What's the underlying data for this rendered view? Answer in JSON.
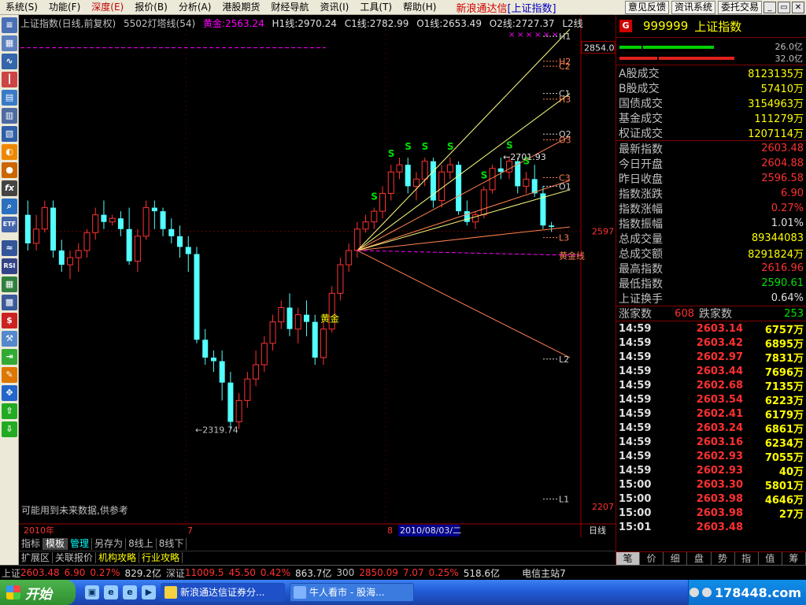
{
  "menubar": {
    "items": [
      "系统(S)",
      "功能(F)",
      "深度(E)",
      "报价(B)",
      "分析(A)",
      "港股期货",
      "财经导航",
      "资讯(I)",
      "工具(T)",
      "帮助(H)"
    ],
    "active_index": 2,
    "app_title": "新浪通达信",
    "app_title_bracket": "[上证指数]",
    "buttons": [
      "意见反馈",
      "资讯系统",
      "委托交易"
    ]
  },
  "chart": {
    "header_name": "上证指数(日线,前复权)",
    "header_tool": "5502灯塔线(54)",
    "header_gold": "黄金:2563.24",
    "header_lines": [
      "H1线:2970.24",
      "C1线:2782.99",
      "O1线:2653.49",
      "O2线:2727.37",
      "L2线"
    ],
    "price_axis": {
      "top_box": "2854.0",
      "mid": "2597",
      "bottom": "2207"
    },
    "annotations": {
      "high": "2701.93",
      "low": "←2319.74",
      "gold": "黄金",
      "gold_line": "黄金线"
    },
    "line_labels": [
      "H1",
      "H2",
      "C2",
      "C1",
      "H3",
      "O2",
      "O3",
      "C3",
      "O1",
      "L3",
      "L2",
      "L1"
    ],
    "signal_label": "S",
    "footnote": "可能用到未来数据,供参考",
    "time_axis": {
      "year": "2010年",
      "m7": "7",
      "m8": "8",
      "cursor_date": "2010/08/03/二",
      "period": "日线"
    }
  },
  "chart_data": {
    "type": "candlestick",
    "ylim": [
      2207,
      2880
    ],
    "candles": [
      [
        2620,
        2640,
        2570,
        2580
      ],
      [
        2580,
        2620,
        2570,
        2600
      ],
      [
        2600,
        2640,
        2595,
        2630
      ],
      [
        2630,
        2640,
        2560,
        2570
      ],
      [
        2570,
        2585,
        2540,
        2550
      ],
      [
        2550,
        2570,
        2530,
        2560
      ],
      [
        2560,
        2580,
        2540,
        2570
      ],
      [
        2570,
        2600,
        2560,
        2595
      ],
      [
        2595,
        2630,
        2585,
        2620
      ],
      [
        2620,
        2640,
        2600,
        2610
      ],
      [
        2610,
        2620,
        2605,
        2615
      ],
      [
        2615,
        2625,
        2590,
        2600
      ],
      [
        2600,
        2630,
        2550,
        2555
      ],
      [
        2555,
        2600,
        2540,
        2590
      ],
      [
        2590,
        2640,
        2585,
        2630
      ],
      [
        2630,
        2640,
        2600,
        2625
      ],
      [
        2625,
        2630,
        2590,
        2600
      ],
      [
        2600,
        2615,
        2580,
        2590
      ],
      [
        2590,
        2605,
        2560,
        2575
      ],
      [
        2575,
        2590,
        2540,
        2565
      ],
      [
        2565,
        2575,
        2440,
        2445
      ],
      [
        2445,
        2460,
        2410,
        2420
      ],
      [
        2420,
        2430,
        2400,
        2415
      ],
      [
        2415,
        2430,
        2360,
        2385
      ],
      [
        2385,
        2400,
        2320,
        2330
      ],
      [
        2330,
        2370,
        2320,
        2360
      ],
      [
        2360,
        2400,
        2350,
        2390
      ],
      [
        2390,
        2430,
        2380,
        2410
      ],
      [
        2410,
        2450,
        2400,
        2440
      ],
      [
        2440,
        2480,
        2430,
        2470
      ],
      [
        2470,
        2500,
        2460,
        2490
      ],
      [
        2490,
        2510,
        2450,
        2460
      ],
      [
        2460,
        2490,
        2440,
        2480
      ],
      [
        2480,
        2500,
        2450,
        2470
      ],
      [
        2470,
        2480,
        2410,
        2420
      ],
      [
        2420,
        2470,
        2410,
        2460
      ],
      [
        2460,
        2520,
        2455,
        2510
      ],
      [
        2510,
        2560,
        2500,
        2550
      ],
      [
        2550,
        2580,
        2540,
        2570
      ],
      [
        2570,
        2610,
        2560,
        2600
      ],
      [
        2600,
        2620,
        2595,
        2610
      ],
      [
        2610,
        2630,
        2600,
        2625
      ],
      [
        2625,
        2660,
        2615,
        2650
      ],
      [
        2650,
        2690,
        2640,
        2680
      ],
      [
        2680,
        2700,
        2670,
        2690
      ],
      [
        2690,
        2700,
        2650,
        2660
      ],
      [
        2660,
        2680,
        2640,
        2670
      ],
      [
        2670,
        2700,
        2660,
        2695
      ],
      [
        2695,
        2700,
        2630,
        2640
      ],
      [
        2640,
        2690,
        2630,
        2680
      ],
      [
        2680,
        2700,
        2670,
        2690
      ],
      [
        2690,
        2695,
        2620,
        2625
      ],
      [
        2625,
        2640,
        2605,
        2610
      ],
      [
        2610,
        2625,
        2600,
        2620
      ],
      [
        2620,
        2660,
        2615,
        2655
      ],
      [
        2655,
        2690,
        2650,
        2685
      ],
      [
        2685,
        2700,
        2670,
        2680
      ],
      [
        2680,
        2702,
        2670,
        2695
      ],
      [
        2695,
        2700,
        2650,
        2660
      ],
      [
        2660,
        2680,
        2650,
        2670
      ],
      [
        2670,
        2690,
        2645,
        2650
      ],
      [
        2650,
        2660,
        2600,
        2605
      ],
      [
        2605,
        2610,
        2596,
        2603
      ]
    ],
    "signals": [
      41,
      43,
      45,
      47,
      50,
      54,
      57,
      59
    ]
  },
  "bottom_tabs": [
    "指标",
    "模板",
    "管理",
    "另存为",
    "8线上",
    "8线下"
  ],
  "ext_tabs": [
    "扩展区",
    "关联报价",
    "机构攻略",
    "行业攻略"
  ],
  "statusbar": {
    "sh_label": "上证",
    "sh_price": "2603.48",
    "sh_chg": "6.90",
    "sh_pct": "0.27%",
    "sh_amt": "829.2亿",
    "sz_label": "深证",
    "sz_price": "11009.5",
    "sz_chg": "45.50",
    "sz_pct": "0.42%",
    "sz_amt": "863.7亿",
    "h300_label": "300",
    "h300_price": "2850.09",
    "h300_chg": "7.07",
    "h300_pct": "0.25%",
    "h300_amt": "518.6亿",
    "server": "电信主站7"
  },
  "right_panel": {
    "badge": "G",
    "code": "999999",
    "name": "上证指数",
    "bar_top": "26.0亿",
    "bar_bottom": "32.0亿",
    "volume_rows": [
      {
        "label": "A股成交",
        "value": "8123135万"
      },
      {
        "label": "B股成交",
        "value": "57410万"
      },
      {
        "label": "国债成交",
        "value": "3154963万"
      },
      {
        "label": "基金成交",
        "value": "111279万"
      },
      {
        "label": "权证成交",
        "value": "1207114万"
      }
    ],
    "price_rows": [
      {
        "label": "最新指数",
        "value": "2603.48",
        "color": "red"
      },
      {
        "label": "今日开盘",
        "value": "2604.88",
        "color": "red"
      },
      {
        "label": "昨日收盘",
        "value": "2596.58",
        "color": "red"
      },
      {
        "label": "指数涨跌",
        "value": "6.90",
        "color": "red"
      },
      {
        "label": "指数涨幅",
        "value": "0.27%",
        "color": "red"
      },
      {
        "label": "指数振幅",
        "value": "1.01%",
        "color": "white"
      },
      {
        "label": "总成交量",
        "value": "89344083",
        "color": "yellow"
      },
      {
        "label": "总成交额",
        "value": "8291824万",
        "color": "yellow"
      },
      {
        "label": "最高指数",
        "value": "2616.96",
        "color": "red"
      },
      {
        "label": "最低指数",
        "value": "2590.61",
        "color": "green"
      },
      {
        "label": "上证换手",
        "value": "0.64%",
        "color": "white"
      }
    ],
    "up_label": "涨家数",
    "up_value": "608",
    "down_label": "跌家数",
    "down_value": "253",
    "ticks": [
      {
        "time": "14:59",
        "price": "2603.14",
        "vol": "6757万"
      },
      {
        "time": "14:59",
        "price": "2603.42",
        "vol": "6895万"
      },
      {
        "time": "14:59",
        "price": "2602.97",
        "vol": "7831万"
      },
      {
        "time": "14:59",
        "price": "2603.44",
        "vol": "7696万"
      },
      {
        "time": "14:59",
        "price": "2602.68",
        "vol": "7135万"
      },
      {
        "time": "14:59",
        "price": "2603.54",
        "vol": "6223万"
      },
      {
        "time": "14:59",
        "price": "2602.41",
        "vol": "6179万"
      },
      {
        "time": "14:59",
        "price": "2603.24",
        "vol": "6861万"
      },
      {
        "time": "14:59",
        "price": "2603.16",
        "vol": "6234万"
      },
      {
        "time": "14:59",
        "price": "2602.93",
        "vol": "7055万"
      },
      {
        "time": "14:59",
        "price": "2602.93",
        "vol": "40万"
      },
      {
        "time": "15:00",
        "price": "2603.30",
        "vol": "5801万"
      },
      {
        "time": "15:00",
        "price": "2603.98",
        "vol": "4646万"
      },
      {
        "time": "15:00",
        "price": "2603.98",
        "vol": "27万"
      },
      {
        "time": "15:01",
        "price": "2603.48",
        "vol": ""
      }
    ],
    "tabs": [
      "笔",
      "价",
      "细",
      "盘",
      "势",
      "指",
      "值",
      "筹"
    ]
  },
  "taskbar": {
    "start": "开始",
    "tasks": [
      "新浪通达信证券分...",
      "牛人看市 - 股海..."
    ],
    "watermark": "178448.com"
  }
}
